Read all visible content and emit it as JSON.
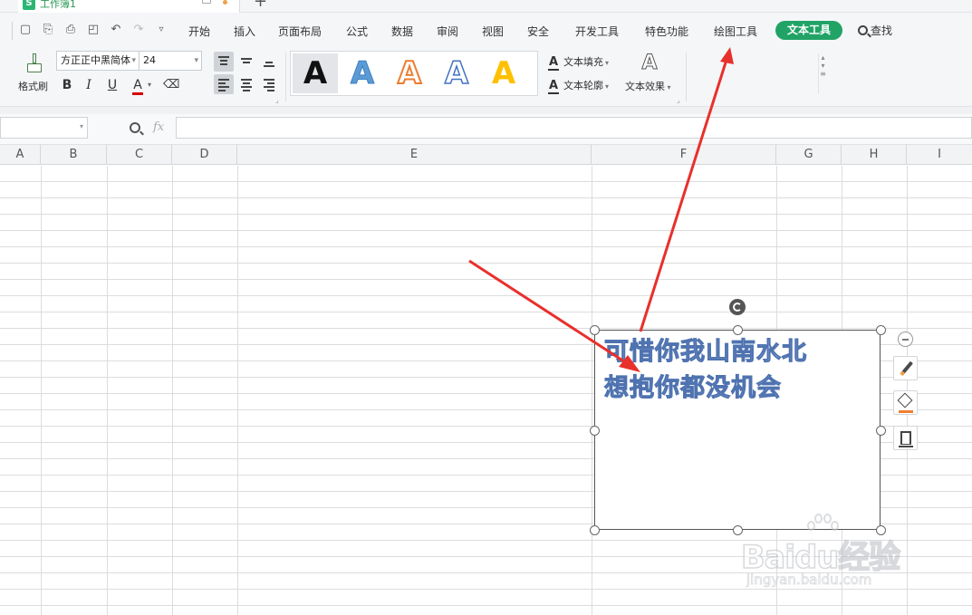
{
  "window": {
    "doc_tab_label": "工作簿1",
    "doc_icon_letter": "S"
  },
  "menubar": {
    "items": [
      "开始",
      "插入",
      "页面布局",
      "公式",
      "数据",
      "审阅",
      "视图",
      "安全",
      "开发工具",
      "特色功能",
      "绘图工具"
    ],
    "active_tab": "文本工具",
    "search_label": "查找"
  },
  "ribbon": {
    "format_painter_label": "格式刷",
    "font_name": "方正正中黑简体",
    "font_size": "24",
    "bold": "B",
    "italic": "I",
    "underline": "U",
    "font_color_glyph": "A",
    "text_styles": [
      "A",
      "A",
      "A",
      "A",
      "A"
    ],
    "text_fill_label": "文本填充",
    "text_outline_label": "文本轮廓",
    "text_effect_label": "文本效果"
  },
  "formula_bar": {
    "name_box_value": "",
    "fx_label": "fx",
    "formula_value": ""
  },
  "sheet": {
    "columns": [
      "A",
      "B",
      "C",
      "D",
      "E",
      "F",
      "G",
      "H",
      "I"
    ]
  },
  "textbox": {
    "lines": [
      "可惜你我山南水北",
      "想抱你都没机会"
    ]
  },
  "watermark": {
    "main": "Baidu经验",
    "sub": "jingyan.baidu.com"
  },
  "colors": {
    "accent_green": "#21a366",
    "arrow_red": "#e8302c",
    "wordart_fill": "#b8cbe8",
    "wordart_stroke": "#4f73b0"
  }
}
